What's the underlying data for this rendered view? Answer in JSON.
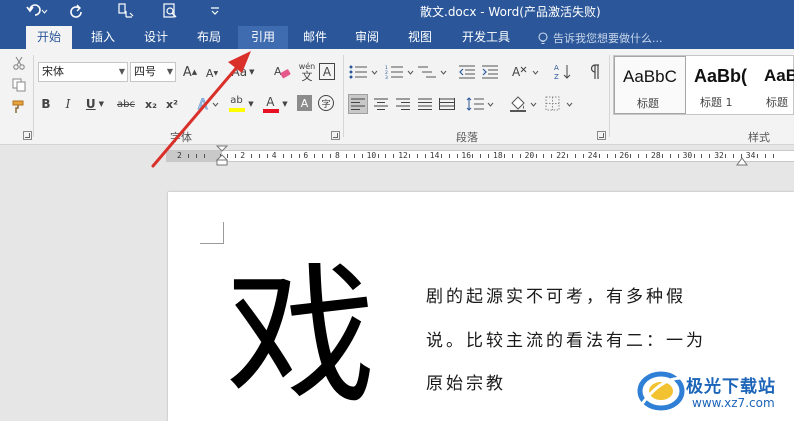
{
  "window": {
    "title": "散文.docx - Word(产品激活失败)"
  },
  "tabs": [
    {
      "label": "开始"
    },
    {
      "label": "插入"
    },
    {
      "label": "设计"
    },
    {
      "label": "布局"
    },
    {
      "label": "引用"
    },
    {
      "label": "邮件"
    },
    {
      "label": "审阅"
    },
    {
      "label": "视图"
    },
    {
      "label": "开发工具"
    }
  ],
  "tell_me": {
    "placeholder": "告诉我您想要做什么..."
  },
  "font_group": {
    "font_name": "宋体",
    "font_size": "四号",
    "grow": "A",
    "shrink": "A",
    "case": "Aa",
    "phonetic": "wén",
    "border_char": "A",
    "bold": "B",
    "italic": "I",
    "underline": "U",
    "strike": "abc",
    "subscript": "x₂",
    "superscript": "x²",
    "highlight": "ab",
    "font_color": "A",
    "shading": "A",
    "enclose": "字",
    "label": "字体"
  },
  "paragraph_group": {
    "label": "段落"
  },
  "styles_group": {
    "label": "样式",
    "items": [
      {
        "preview": "AaBbC",
        "name": "标题"
      },
      {
        "preview": "AaBb(",
        "name": "标题 1"
      },
      {
        "preview": "AaBb",
        "name": "标题"
      }
    ]
  },
  "ruler": {
    "numbers": [
      "2",
      "",
      "2",
      "4",
      "6",
      "8",
      "10",
      "12",
      "14",
      "16",
      "18",
      "20",
      "22",
      "24",
      "26",
      "28",
      "30",
      "32",
      "34"
    ]
  },
  "document": {
    "dropcap": "戏",
    "lines": [
      "剧的起源实不可考，有多种假",
      "说。比较主流的看法有二：一为",
      "原始宗教"
    ]
  },
  "watermark": {
    "name": "极光下载站",
    "url": "www.xz7.com"
  },
  "colors": {
    "titlebar": "#2b579a",
    "ribbon": "#f3f3f3",
    "arrow": "#d9302a",
    "highlight_yellow": "#ffff00",
    "font_red": "#e81123"
  }
}
